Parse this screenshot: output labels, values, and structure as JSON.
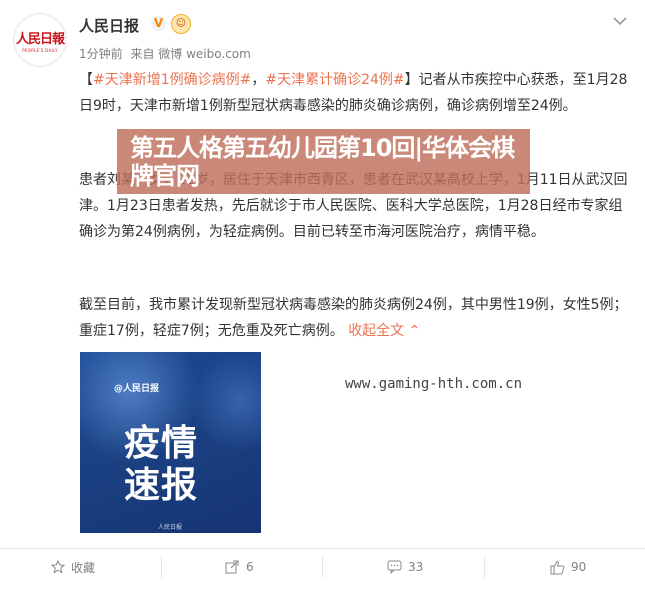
{
  "post": {
    "username": "人民日报",
    "verified_mark": "V",
    "badge_emoji": "☺",
    "logo_text": "人民日報",
    "logo_subtext": "PEOPLE'S DAILY",
    "time": "1分钟前",
    "source": "来自 微博 weibo.com",
    "hashtag1": "#天津新增1例确诊病例#",
    "hashtag_sep": "，",
    "hashtag2": "#天津累计确诊24例#",
    "para1_rest": "记者从市疾控中心获悉，至1月28日9时，天津市新增1例新型冠状病毒感染的肺炎确诊病例，确诊病例增至24例。",
    "para2": "患者刘某，女，22岁，居住于天津市西青区，患者在武汉某高校上学，1月11日从武汉回津。1月23日患者发热，先后就诊于市人民医院、医科大学总医院，1月28日经市专家组确诊为第24例病例，为轻症病例。目前已转至市海河医院治疗，病情平稳。",
    "para3": "截至目前，我市累计发现新型冠状病毒感染的肺炎病例24例，其中男性19例，女性5例；重症17例，轻症7例；无危重及死亡病例。",
    "collapse_link": "收起全文",
    "collapse_arrow": "⌃"
  },
  "overlay": {
    "watermark_text": "第五人格第五幼儿园第10回|华体会棋牌官网",
    "watermark_url": "www.gaming-hth.com.cn"
  },
  "thumbnail": {
    "brand": "@人民日报",
    "line1": "疫情",
    "line2": "速报",
    "footer": "人民日报"
  },
  "actions": {
    "favorite_label": "收藏",
    "repost_count": "6",
    "comment_count": "33",
    "like_count": "90"
  },
  "colors": {
    "accent": "#eb7350",
    "verified": "#ff8200",
    "logo_red": "#c8161d"
  }
}
